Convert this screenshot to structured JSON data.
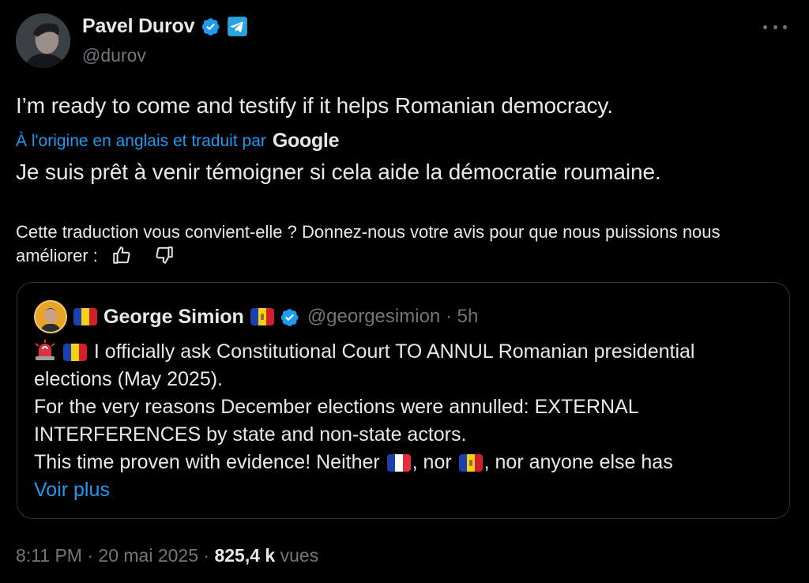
{
  "author": {
    "display_name": "Pavel Durov",
    "handle": "@durov",
    "avatar_icon": "user-avatar-photo",
    "badges": [
      "verified-badge-icon",
      "telegram-badge-icon"
    ]
  },
  "tweet": {
    "text": "I’m ready to come and testify if it helps Romanian democracy.",
    "translation_label": "À l'origine en anglais et traduit par",
    "translation_provider": "Google",
    "translated_text": "Je suis prêt à venir témoigner si cela aide la démocratie roumaine.",
    "feedback_prompt": "Cette traduction vous convient-elle ? Donnez-nous votre avis pour que nous puissions nous améliorer :"
  },
  "quote": {
    "display_name": "George Simion",
    "handle": "@georgesimion",
    "separator": "·",
    "time": "5h",
    "lines": [
      "I officially ask Constitutional Court TO ANNUL Romanian presidential",
      "elections (May 2025).",
      "For the very reasons December elections were annulled: EXTERNAL",
      "INTERFERENCES by state and non-state actors."
    ],
    "last_line_parts": [
      "This time proven with evidence! Neither",
      ", nor",
      ", nor anyone else has"
    ],
    "see_more": "Voir plus"
  },
  "meta": {
    "time": "8:11 PM",
    "dot": "·",
    "date": "20 mai 2025",
    "views_count": "825,4 k",
    "views_label": "vues"
  },
  "colors": {
    "background": "#000000",
    "text": "#e7e9ea",
    "muted": "#71767b",
    "link": "#1d9bf0",
    "border": "#2f3336"
  }
}
